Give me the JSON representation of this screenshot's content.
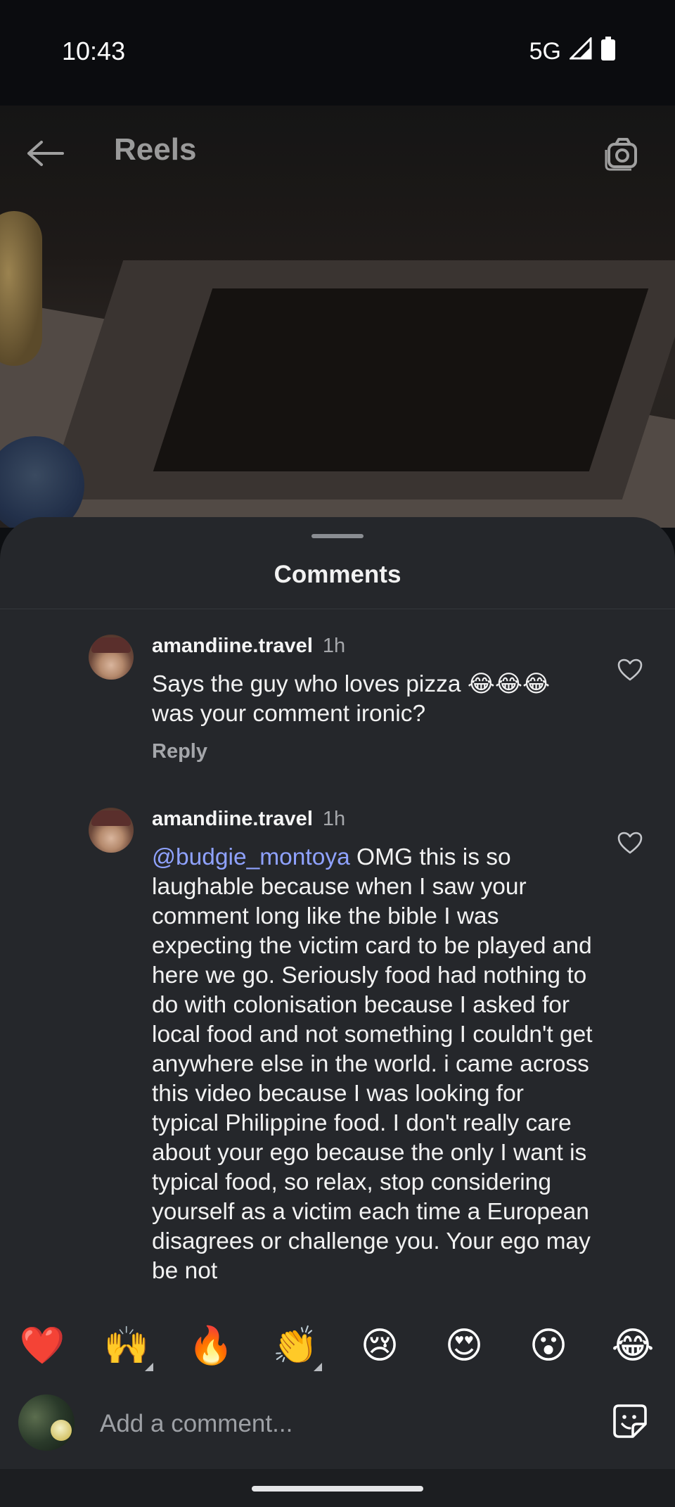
{
  "status_bar": {
    "time": "10:43",
    "network": "5G",
    "signal_icon": "signal-icon",
    "battery_icon": "battery-icon"
  },
  "header": {
    "title": "Reels",
    "back_icon": "arrow-left-icon",
    "camera_icon": "camera-icon"
  },
  "sheet": {
    "title": "Comments",
    "comments": [
      {
        "username": "amandiine.travel",
        "time": "1h",
        "text": "Says the guy who loves pizza 😂😂😂 was your comment ironic?",
        "reply_label": "Reply"
      },
      {
        "username": "amandiine.travel",
        "time": "1h",
        "mention": "@budgie_montoya",
        "text": " OMG this is so laughable because when I saw your comment long like the bible I was expecting the victim card to be played and here we go. Seriously food had nothing to do with colonisation because I asked for local food and not something I couldn't get anywhere else in the world. i came across this video because I was looking for typical Philippine food. I don't really care about your ego because the only I want is typical food, so relax, stop considering yourself as a victim each time a European disagrees or challenge you. Your ego may be not"
      }
    ]
  },
  "emoji_bar": [
    "❤️",
    "🙌",
    "🔥",
    "👏",
    "😢",
    "😍",
    "😮",
    "😂"
  ],
  "composer": {
    "placeholder": "Add a comment...",
    "sticker_icon": "sticker-icon"
  },
  "colors": {
    "sheet_bg": "#25272b",
    "mention": "#8fa2ff",
    "muted_text": "#a5a7ab"
  }
}
